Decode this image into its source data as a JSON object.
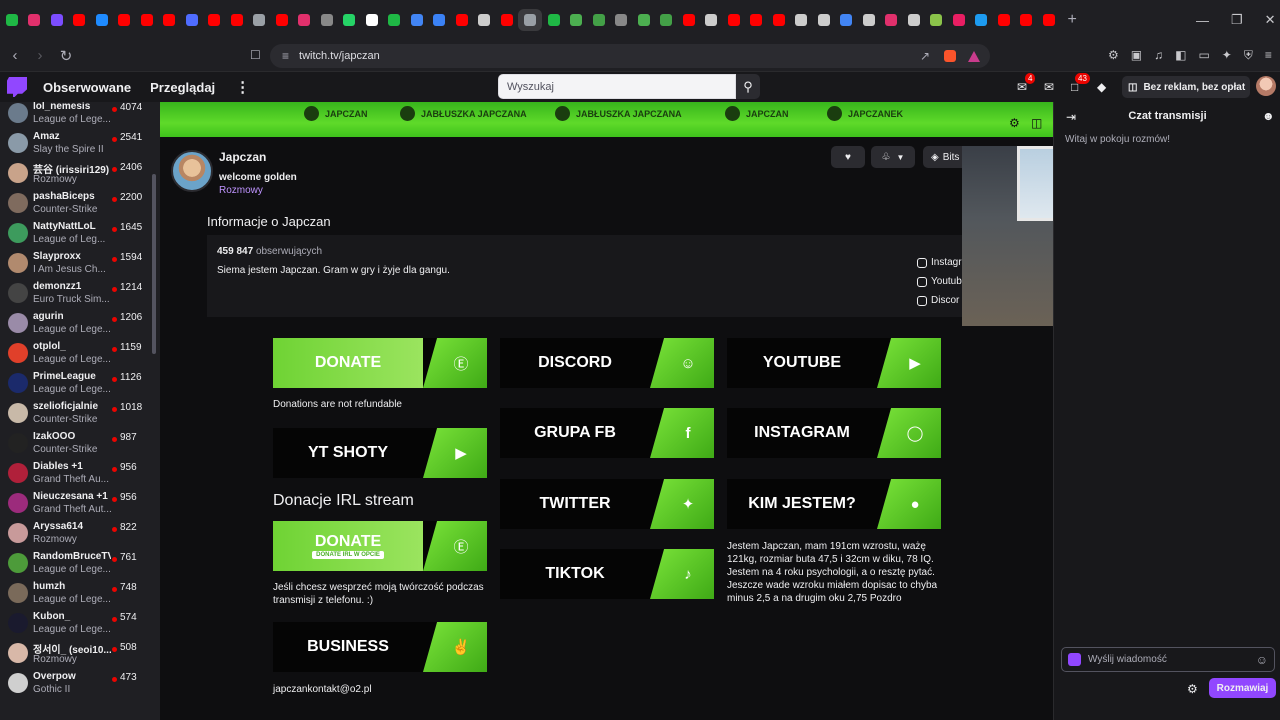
{
  "browser": {
    "tab_colors": [
      "#1fb845",
      "#e1306c",
      "#7c4dff",
      "#ff0000",
      "#1f8bff",
      "#ff0000",
      "#ff0000",
      "#ff0000",
      "#4f6cff",
      "#ff0000",
      "#ff0000",
      "#9aa0a6",
      "#ff0000",
      "#e1306c",
      "#888888",
      "#25d366",
      "#ffffff",
      "#1fb845",
      "#4285f4",
      "#3b82f6",
      "#ff0000",
      "#cccccc",
      "#ff0000",
      "#9aa0a6",
      "#1fb845",
      "#4caf50",
      "#43a047",
      "#888888",
      "#4caf50",
      "#43a047",
      "#ff0000",
      "#cccccc",
      "#ff0000",
      "#ff0000",
      "#ff0000",
      "#cccccc",
      "#cccccc",
      "#4285f4",
      "#cccccc",
      "#e1306c",
      "#cccccc",
      "#8bc34a",
      "#e91e63",
      "#1d9bf0",
      "#ff0000",
      "#ff0000",
      "#ff0000"
    ],
    "url": "twitch.tv/japczan",
    "new_tab_icon": "plus-icon"
  },
  "topnav": {
    "following": "Obserwowane",
    "browse": "Przeglądaj",
    "search_placeholder": "Wyszukaj",
    "inbox_badge": "4",
    "notif_badge": "43",
    "no_ads": "Bez reklam, bez opłat"
  },
  "sidebar": {
    "channels": [
      {
        "name": "lol_nemesis",
        "game": "League of Lege...",
        "viewers": "4074",
        "color": "#6b7b8c"
      },
      {
        "name": "Amaz",
        "game": "Slay the Spire II",
        "viewers": "2541",
        "color": "#8a9aa8"
      },
      {
        "name": "芸谷 (irissiri129)",
        "game": "Rozmowy",
        "viewers": "2406",
        "color": "#c9a38a"
      },
      {
        "name": "pashaBiceps",
        "game": "Counter-Strike",
        "viewers": "2200",
        "color": "#7f6b5e"
      },
      {
        "name": "NattyNattLoL",
        "game": "League of Leg...",
        "viewers": "1645",
        "color": "#3d9b5d"
      },
      {
        "name": "Slayproxx",
        "game": "I Am Jesus Ch...",
        "viewers": "1594",
        "color": "#b18a6e"
      },
      {
        "name": "demonzz1",
        "game": "Euro Truck Sim...",
        "viewers": "1214",
        "color": "#444444"
      },
      {
        "name": "agurin",
        "game": "League of Lege...",
        "viewers": "1206",
        "color": "#9a8ba8"
      },
      {
        "name": "otplol_",
        "game": "League of Lege...",
        "viewers": "1159",
        "color": "#e0402a"
      },
      {
        "name": "PrimeLeague",
        "game": "League of Lege...",
        "viewers": "1126",
        "color": "#1b2a6b"
      },
      {
        "name": "szelioficjalnie",
        "game": "Counter-Strike",
        "viewers": "1018",
        "color": "#c8b9a8"
      },
      {
        "name": "IzakOOO",
        "game": "Counter-Strike",
        "viewers": "987",
        "color": "#222222"
      },
      {
        "name": "Diables +1",
        "game": "Grand Theft Au...",
        "viewers": "956",
        "color": "#b0203a"
      },
      {
        "name": "Nieuczesana +1",
        "game": "Grand Theft Aut...",
        "viewers": "956",
        "color": "#9c2b7c"
      },
      {
        "name": "Aryssa614",
        "game": "Rozmowy",
        "viewers": "822",
        "color": "#c89a9a"
      },
      {
        "name": "RandomBruceTV",
        "game": "League of Lege...",
        "viewers": "761",
        "color": "#4d9b3a"
      },
      {
        "name": "humzh",
        "game": "League of Lege...",
        "viewers": "748",
        "color": "#7a6a5a"
      },
      {
        "name": "Kubon_",
        "game": "League of Lege...",
        "viewers": "574",
        "color": "#1a1a2e"
      },
      {
        "name": "정서이_ (seoi10...",
        "game": "Rozmowy",
        "viewers": "508",
        "color": "#d8b8a8"
      },
      {
        "name": "Overpow",
        "game": "Gothic II",
        "viewers": "473",
        "color": "#cfcfcf"
      }
    ]
  },
  "banner": {
    "items": [
      {
        "label": "JAPCZAN",
        "icon": "facebook-icon"
      },
      {
        "label": "JABŁUSZKA JAPCZANA",
        "icon": "group-icon"
      },
      {
        "label": "JABŁUSZKA JAPCZANA",
        "icon": "discord-icon"
      },
      {
        "label": "JAPCZAN",
        "icon": "youtube-icon"
      },
      {
        "label": "JAPCZANEK",
        "icon": "instagram-icon"
      }
    ]
  },
  "channel": {
    "name": "Japczan",
    "title": "welcome golden",
    "category": "Rozmowy",
    "bits": "Bits",
    "about_heading": "Informacje o Japczan",
    "followers_count": "459 847",
    "followers_label": "obserwujących",
    "bio": "Siema jestem Japczan. Gram w gry i żyje dla gangu.",
    "socials": [
      "Instagr",
      "Youtub",
      "Discor"
    ]
  },
  "panels": {
    "donate": "DONATE",
    "donate_note": "Donations are not refundable",
    "yt_shoty": "YT SHOTY",
    "irl_heading": "Donacje IRL stream",
    "donate_irl": "DONATE",
    "donate_irl_sub": "DONATE IRL W OPCIE",
    "irl_note": "Jeśli chcesz wesprzeć moją twórczość podczas transmisji z telefonu. :)",
    "business": "BUSINESS",
    "business_email": "japczankontakt@o2.pl",
    "discord": "DISCORD",
    "grupa_fb": "GRUPA FB",
    "twitter": "TWITTER",
    "tiktok": "TIKTOK",
    "youtube": "YOUTUBE",
    "instagram": "INSTAGRAM",
    "kim_jestem": "KIM JESTEM?",
    "kim_text": "Jestem Japczan, mam 191cm wzrostu, ważę 121kg, rozmiar buta 47,5 i 32cm w diku, 78 IQ. Jestem na 4 roku psychologii, a o resztę pytać. Jeszcze wade wzroku miałem dopisac to chyba minus 2,5 a na drugim oku 2,75 Pozdro"
  },
  "chat": {
    "header": "Czat transmisji",
    "welcome": "Witaj w pokoju rozmów!",
    "input_placeholder": "Wyślij wiadomość",
    "send": "Rozmawiaj"
  }
}
